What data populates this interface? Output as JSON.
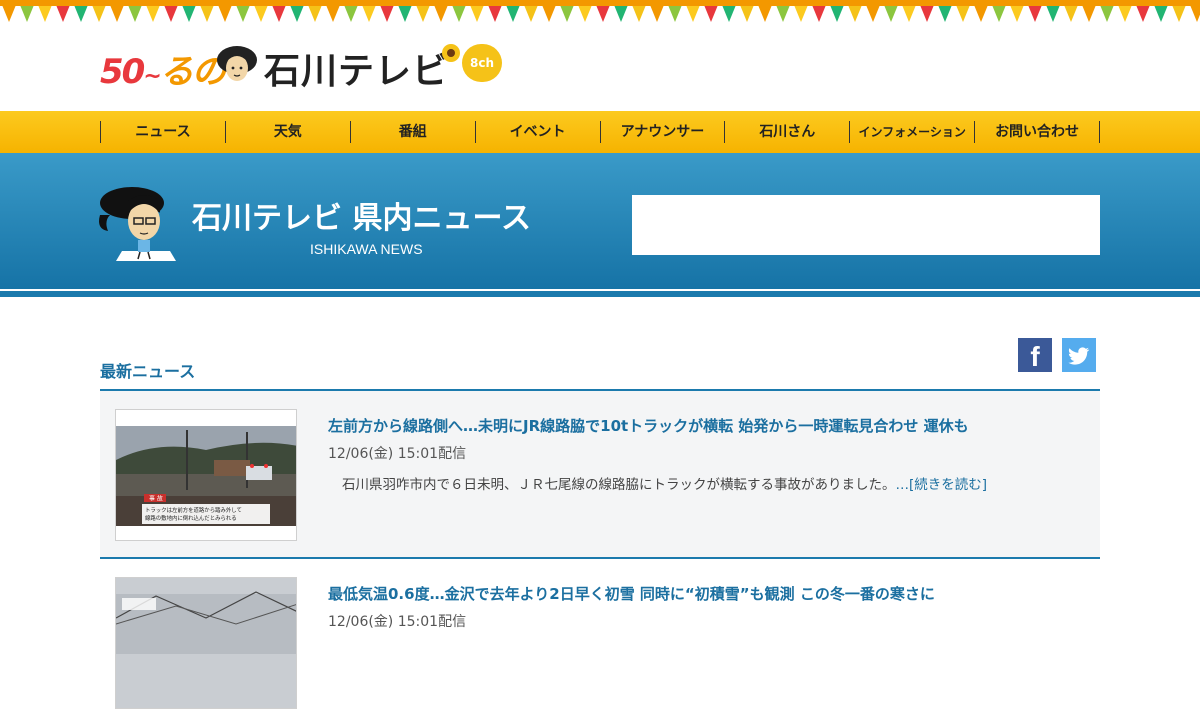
{
  "header": {
    "logo_50": "50",
    "logo_tilde": "~",
    "logo_ru": "るの",
    "logo_name": "石川テレビ",
    "logo_channel": "8ch"
  },
  "nav": {
    "items": [
      {
        "label": "ニュース"
      },
      {
        "label": "天気"
      },
      {
        "label": "番組"
      },
      {
        "label": "イベント"
      },
      {
        "label": "アナウンサー"
      },
      {
        "label": "石川さん"
      },
      {
        "label": "インフォメーション"
      },
      {
        "label": "お問い合わせ"
      }
    ]
  },
  "banner": {
    "title": "石川テレビ 県内ニュース",
    "subtitle": "ISHIKAWA NEWS"
  },
  "section": {
    "title": "最新ニュース",
    "social": {
      "facebook": "facebook-icon",
      "twitter": "twitter-icon"
    }
  },
  "news": [
    {
      "title": "左前方から線路側へ…未明にJR線路脇で10tトラックが横転 始発から一時運転見合わせ 運休も",
      "date": "12/06(金) 15:01配信",
      "body": "石川県羽咋市内で６日未明、ＪＲ七尾線の線路脇にトラックが横転する事故がありました。",
      "more": "…[続きを読む]",
      "thumb_caption_tag": "事 故",
      "thumb_caption": "トラックは左前方を道路から踏み外して 線路の敷地内に倒れ込んだとみられる"
    },
    {
      "title": "最低気温0.6度…金沢で去年より2日早く初雪 同時に“初積雪”も観測 この冬一番の寒さに",
      "date": "12/06(金) 15:01配信"
    }
  ],
  "colors": {
    "nav_yellow": "#f6b300",
    "banner_blue": "#1673a6",
    "link_blue": "#1b6fa0"
  }
}
